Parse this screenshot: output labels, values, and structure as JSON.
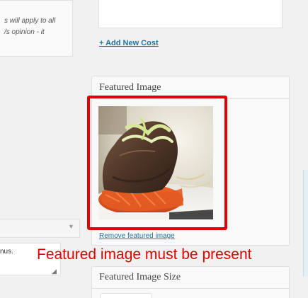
{
  "left": {
    "note_text": "s will apply to all\n/s opinion - it",
    "textarea_value": "nus."
  },
  "costs": {
    "add_new_cost_label": "+ Add New Cost"
  },
  "featured_image": {
    "title": "Featured Image",
    "remove_label": "Remove featured image",
    "image_alt": "Featured image of a plated dish"
  },
  "annotation": {
    "text": "Featured image must be present",
    "color": "#e00000"
  },
  "featured_image_size": {
    "title": "Featured Image Size"
  },
  "icons": {
    "dropdown_arrow": "chevron-down-icon",
    "resize_grip": "resize-grip-icon"
  },
  "colors": {
    "link": "#21759b",
    "highlight": "#e00000",
    "panel_bg": "#f9f9f9",
    "border": "#dfdfdf"
  }
}
